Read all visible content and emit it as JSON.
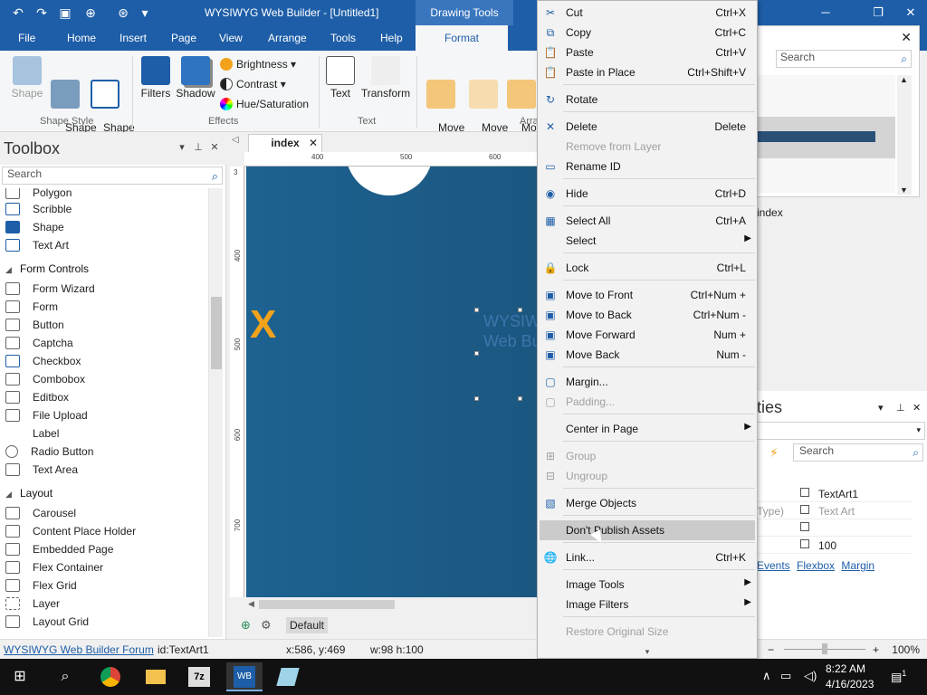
{
  "window": {
    "title": "WYSIWYG Web Builder - [Untitled1]",
    "context_tab_group": "Drawing Tools"
  },
  "ribbon": {
    "tabs": [
      "File",
      "Home",
      "Insert",
      "Page",
      "View",
      "Arrange",
      "Tools",
      "Help"
    ],
    "active_context_tab": "Format",
    "shape_style": {
      "group": "Shape Style",
      "shape": "Shape",
      "shape_fill": "Shape\nFill",
      "shape_border": "Shape\nBorder"
    },
    "effects": {
      "group": "Effects",
      "filters": "Filters",
      "shadow": "Shadow",
      "brightness": "Brightness",
      "contrast": "Contrast",
      "hue_saturation": "Hue/Saturation"
    },
    "text": {
      "group": "Text",
      "text": "Text",
      "transform": "Transform"
    },
    "arrange": {
      "group": "Arra",
      "move_to_front": "Move\nto Front",
      "move_to_back": "Move\nto Back",
      "move_forward": "Move\nForwar"
    }
  },
  "toolbox": {
    "title": "Toolbox",
    "search_placeholder": "Search",
    "items_top": [
      "Polygon",
      "Scribble",
      "Shape",
      "Text Art"
    ],
    "category_form": "Form Controls",
    "form_items": [
      "Form Wizard",
      "Form",
      "Button",
      "Captcha",
      "Checkbox",
      "Combobox",
      "Editbox",
      "File Upload",
      "Label",
      "Radio Button",
      "Text Area"
    ],
    "category_layout": "Layout",
    "layout_items": [
      "Carousel",
      "Content Place Holder",
      "Embedded Page",
      "Flex Container",
      "Flex Grid",
      "Layer",
      "Layout Grid"
    ]
  },
  "document": {
    "tab": "index",
    "ruler_h": [
      "400",
      "500",
      "600"
    ],
    "ruler_v": [
      "3",
      "400",
      "500",
      "600",
      "700"
    ],
    "canvas_text": "X",
    "watermark": "WYSIWYG\nWeb Builder",
    "page_name": "Default"
  },
  "statusbar": {
    "forum_link": "WYSIWYG Web Builder Forum",
    "id": "id:TextArt1",
    "coords": "x:586, y:469",
    "size": "w:98 h:100",
    "zoom": "100%"
  },
  "site_panel": {
    "search_placeholder": "Search",
    "page_label": "index"
  },
  "properties": {
    "title": "ties",
    "search_placeholder": "Search",
    "rows": [
      {
        "key": "",
        "value": "TextArt1"
      },
      {
        "key": "Type)",
        "value": "Text Art"
      },
      {
        "key": "",
        "value": ""
      },
      {
        "key": "",
        "value": "100"
      }
    ],
    "links": [
      "Events",
      "Flexbox",
      "Margin"
    ]
  },
  "context_menu": {
    "items": [
      {
        "label": "Cut",
        "shortcut": "Ctrl+X",
        "icon": "scissors-icon",
        "glyph": "✂"
      },
      {
        "label": "Copy",
        "shortcut": "Ctrl+C",
        "icon": "copy-icon",
        "glyph": "⧉"
      },
      {
        "label": "Paste",
        "shortcut": "Ctrl+V",
        "icon": "paste-icon",
        "glyph": "📋"
      },
      {
        "label": "Paste in Place",
        "shortcut": "Ctrl+Shift+V",
        "icon": "paste-in-place-icon",
        "glyph": "📋"
      },
      {
        "label": "Rotate",
        "shortcut": "",
        "icon": "rotate-icon",
        "glyph": "↻"
      },
      {
        "label": "Delete",
        "shortcut": "Delete",
        "icon": "delete-icon",
        "glyph": "✕"
      },
      {
        "label": "Remove from Layer",
        "shortcut": "",
        "icon": "",
        "glyph": "",
        "disabled": true
      },
      {
        "label": "Rename ID",
        "shortcut": "",
        "icon": "rename-id-icon",
        "glyph": "▭"
      },
      {
        "label": "Hide",
        "shortcut": "Ctrl+D",
        "icon": "eye-icon",
        "glyph": "◉"
      },
      {
        "label": "Select All",
        "shortcut": "Ctrl+A",
        "icon": "select-all-icon",
        "glyph": "▦"
      },
      {
        "label": "Select",
        "shortcut": "",
        "icon": "",
        "glyph": "",
        "submenu": true
      },
      {
        "label": "Lock",
        "shortcut": "Ctrl+L",
        "icon": "lock-icon",
        "glyph": "🔒"
      },
      {
        "label": "Move to Front",
        "shortcut": "Ctrl+Num +",
        "icon": "move-to-front-icon",
        "glyph": "▣"
      },
      {
        "label": "Move to Back",
        "shortcut": "Ctrl+Num -",
        "icon": "move-to-back-icon",
        "glyph": "▣"
      },
      {
        "label": "Move Forward",
        "shortcut": "Num +",
        "icon": "move-forward-icon",
        "glyph": "▣"
      },
      {
        "label": "Move Back",
        "shortcut": "Num -",
        "icon": "move-back-icon",
        "glyph": "▣"
      },
      {
        "label": "Margin...",
        "shortcut": "",
        "icon": "margin-icon",
        "glyph": "▢"
      },
      {
        "label": "Padding...",
        "shortcut": "",
        "icon": "padding-icon",
        "glyph": "▢",
        "disabled": true
      },
      {
        "label": "Center in Page",
        "shortcut": "",
        "icon": "",
        "glyph": "",
        "submenu": true
      },
      {
        "label": "Group",
        "shortcut": "",
        "icon": "group-icon",
        "glyph": "⊞",
        "disabled": true
      },
      {
        "label": "Ungroup",
        "shortcut": "",
        "icon": "ungroup-icon",
        "glyph": "⊟",
        "disabled": true
      },
      {
        "label": "Merge Objects",
        "shortcut": "",
        "icon": "merge-objects-icon",
        "glyph": "▧"
      },
      {
        "label": "Don't Publish Assets",
        "shortcut": "",
        "icon": "",
        "glyph": "",
        "hover": true
      },
      {
        "label": "Link...",
        "shortcut": "Ctrl+K",
        "icon": "globe-link-icon",
        "glyph": "🌐"
      },
      {
        "label": "Image Tools",
        "shortcut": "",
        "icon": "",
        "glyph": "",
        "submenu": true
      },
      {
        "label": "Image Filters",
        "shortcut": "",
        "icon": "",
        "glyph": "",
        "submenu": true
      },
      {
        "label": "Restore Original Size",
        "shortcut": "",
        "icon": "",
        "glyph": "",
        "disabled": true
      }
    ]
  },
  "taskbar": {
    "time": "8:22 AM",
    "date": "4/16/2023",
    "notification_count": "1"
  },
  "colors": {
    "titlebar": "#1e5ea8",
    "canvas": "#1d6291",
    "accent_x": "#f2a31b"
  }
}
